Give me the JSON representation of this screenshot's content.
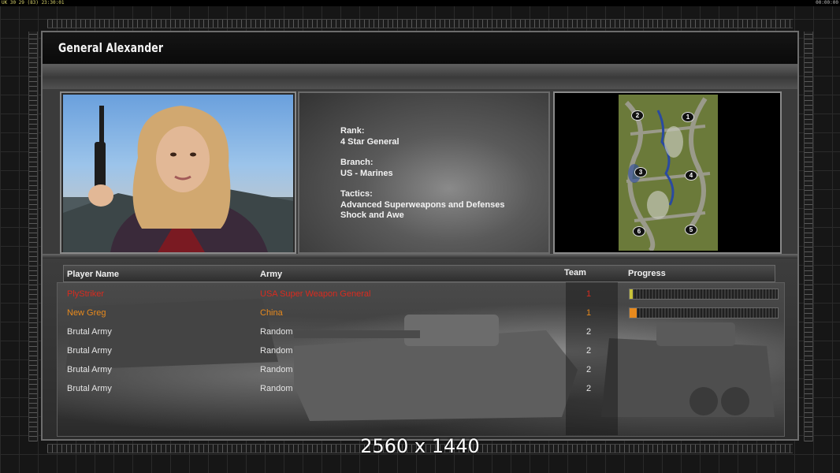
{
  "status_bar": {
    "left": "UK 30 29 (83) 23:30:01",
    "right": "00:00:00"
  },
  "general": {
    "name": "General Alexander",
    "rank_label": "Rank:",
    "rank": "4 Star General",
    "branch_label": "Branch:",
    "branch": "US - Marines",
    "tactics_label": "Tactics:",
    "tactics": [
      "Advanced Superweapons and Defenses",
      "Shock and Awe"
    ]
  },
  "map": {
    "start_positions": [
      "2",
      "1",
      "3",
      "4",
      "6",
      "5"
    ]
  },
  "lobby": {
    "headers": {
      "player": "Player Name",
      "army": "Army",
      "team": "Team",
      "progress": "Progress"
    },
    "players": [
      {
        "name": "PlyStriker",
        "army": "USA Super Weapon General",
        "team": "1",
        "progress": 0.01,
        "color": "#d92b1f"
      },
      {
        "name": "New Greg",
        "army": "China",
        "team": "1",
        "progress": 0.05,
        "color": "#e88a1d"
      },
      {
        "name": "Brutal Army",
        "army": "Random",
        "team": "2",
        "progress": null,
        "color": "#e6e6e6"
      },
      {
        "name": "Brutal Army",
        "army": "Random",
        "team": "2",
        "progress": null,
        "color": "#e6e6e6"
      },
      {
        "name": "Brutal Army",
        "army": "Random",
        "team": "2",
        "progress": null,
        "color": "#e6e6e6"
      },
      {
        "name": "Brutal Army",
        "army": "Random",
        "team": "2",
        "progress": null,
        "color": "#e6e6e6"
      }
    ]
  },
  "watermark": "2560 x 1440",
  "colors": {
    "frame": "#6d6d6d",
    "background": "#161616",
    "progress_p1": "#c8c23a",
    "progress_p2": "#e88a1d"
  }
}
